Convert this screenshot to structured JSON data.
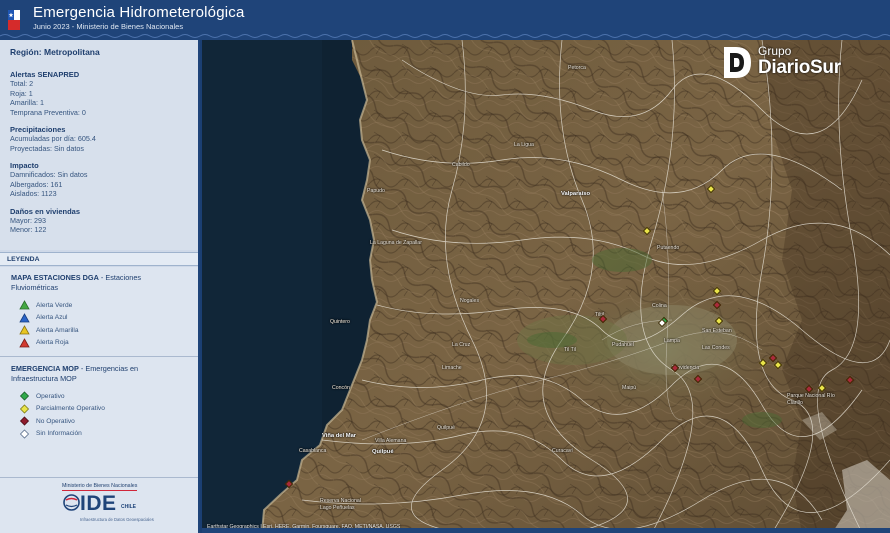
{
  "header": {
    "title": "Emergencia Hidrometerológica",
    "subtitle": "Junio 2023 - Ministerio de Bienes Nacionales"
  },
  "summary": {
    "region": "Región: Metropolitana",
    "alerts": {
      "title": "Alertas SENAPRED",
      "lines": [
        "Total: 2",
        "Roja: 1",
        "Amarilla: 1",
        "Temprana Preventiva: 0"
      ]
    },
    "precip": {
      "title": "Precipitaciones",
      "lines": [
        "Acumuladas por día: 605.4",
        "Proyectadas: Sin datos"
      ]
    },
    "impact": {
      "title": "Impacto",
      "lines": [
        "Damnificados: Sin datos",
        "Albergados: 161",
        "Aislados: 1123"
      ]
    },
    "damage": {
      "title": "Daños en viviendas",
      "lines": [
        "Mayor: 293",
        "Menor: 122"
      ]
    }
  },
  "legend": {
    "header": "LEYENDA",
    "dga_title_bold": "MAPA ESTACIONES DGA",
    "dga_title_light": " - Estaciones Fluviométricas",
    "dga_items": [
      {
        "label": "Alerta Verde",
        "icon": "triangle-icon",
        "color": "#43a843"
      },
      {
        "label": "Alerta Azul",
        "icon": "triangle-icon",
        "color": "#2a64c8"
      },
      {
        "label": "Alerta Amarilla",
        "icon": "triangle-icon",
        "color": "#e8c623"
      },
      {
        "label": "Alerta Roja",
        "icon": "triangle-icon",
        "color": "#d23a30"
      }
    ],
    "mop_title_bold": "EMERGENCIA MOP",
    "mop_title_light": " - Emergencias en Infraestructura MOP",
    "mop_items": [
      {
        "label": "Operativo",
        "icon": "diamond-icon",
        "color": "#2fa84a"
      },
      {
        "label": "Parcialmente Operativo",
        "icon": "diamond-icon",
        "color": "#e9e44a"
      },
      {
        "label": "No Operativo",
        "icon": "diamond-icon",
        "color": "#8e1b2d"
      },
      {
        "label": "Sin Información",
        "icon": "diamond-icon",
        "color": "#ffffff"
      }
    ]
  },
  "logo": {
    "ministry": "Ministerio de Bienes Nacionales",
    "ide": "IDE",
    "chile": "CHILE",
    "infra": "Infraestructura de Datos Geoespaciales"
  },
  "brand": {
    "group": "Grupo",
    "name": "DiarioSur"
  },
  "map": {
    "attribution": "Earthstar Geographics | Esri, HERE, Garmin, Foursquare, FAO, METI/NASA, USGS",
    "places": [
      {
        "name": "Petorca",
        "major": false
      },
      {
        "name": "La Ligua",
        "major": false
      },
      {
        "name": "Cabildo",
        "major": false
      },
      {
        "name": "Papudo",
        "major": false
      },
      {
        "name": "Valparaíso",
        "major": true
      },
      {
        "name": "Putaendo",
        "major": false
      },
      {
        "name": "La Laguna de Zapallar",
        "major": false
      },
      {
        "name": "Nogales",
        "major": false
      },
      {
        "name": "Quintero",
        "major": false
      },
      {
        "name": "La Cruz",
        "major": false
      },
      {
        "name": "Limache",
        "major": false
      },
      {
        "name": "Colina",
        "major": false
      },
      {
        "name": "Tiltil",
        "major": false
      },
      {
        "name": "Lampa",
        "major": false
      },
      {
        "name": "Pudahuel",
        "major": false
      },
      {
        "name": "Til Til",
        "major": false
      },
      {
        "name": "San Esteban",
        "major": false
      },
      {
        "name": "Providencia",
        "major": false
      },
      {
        "name": "Las Condes",
        "major": false
      },
      {
        "name": "Concón",
        "major": false
      },
      {
        "name": "Quilpué",
        "major": false
      },
      {
        "name": "Villa Alemana",
        "major": false
      },
      {
        "name": "Viña del Mar",
        "major": true
      },
      {
        "name": "Quilpué",
        "major": true
      },
      {
        "name": "Casablanca",
        "major": false
      },
      {
        "name": "Reserva Nacional Lago Peñuelas",
        "major": false
      },
      {
        "name": "Curacaví",
        "major": false
      },
      {
        "name": "Maipú",
        "major": false
      },
      {
        "name": "Parque Nacional Río Clarillo",
        "major": false
      }
    ]
  },
  "colors": {
    "header_bg": "#1f4479",
    "sidebar_bg": "#d7e0ec",
    "text_dark": "#1f3f6e"
  }
}
